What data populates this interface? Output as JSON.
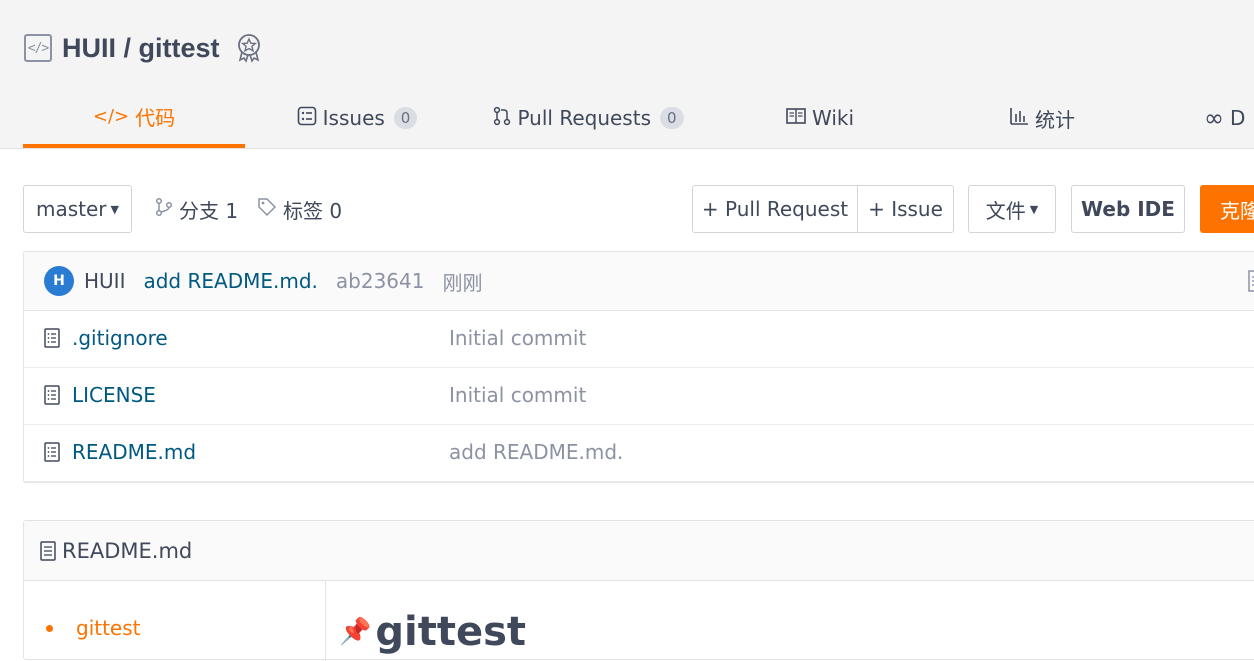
{
  "repo": {
    "owner_name": "HUII / gittest"
  },
  "tabs": [
    {
      "icon": "code-icon",
      "label": "代码",
      "active": true
    },
    {
      "icon": "issues-icon",
      "label": "Issues",
      "count": "0"
    },
    {
      "icon": "pull-request-icon",
      "label": "Pull Requests",
      "count": "0"
    },
    {
      "icon": "wiki-icon",
      "label": "Wiki"
    },
    {
      "icon": "stats-icon",
      "label": "统计"
    },
    {
      "icon": "devops-icon",
      "label": "D"
    }
  ],
  "toolbar": {
    "branch_select": "master",
    "branches_label": "分支 1",
    "tags_label": "标签 0",
    "pull_request_btn": "+ Pull Request",
    "issue_btn": "+ Issue",
    "file_btn": "文件",
    "webide_btn": "Web IDE",
    "clone_btn": "克隆"
  },
  "commit": {
    "avatar_letter": "H",
    "author": "HUII",
    "message": "add README.md.",
    "sha": "ab23641",
    "time": "刚刚"
  },
  "files": [
    {
      "name": ".gitignore",
      "message": "Initial commit"
    },
    {
      "name": "LICENSE",
      "message": "Initial commit"
    },
    {
      "name": "README.md",
      "message": "add README.md."
    }
  ],
  "readme": {
    "filename": "README.md",
    "toc": [
      "gittest"
    ],
    "heading": "gittest"
  },
  "colors": {
    "accent": "#fe7300",
    "link": "#005980",
    "muted": "#8c92a4"
  }
}
